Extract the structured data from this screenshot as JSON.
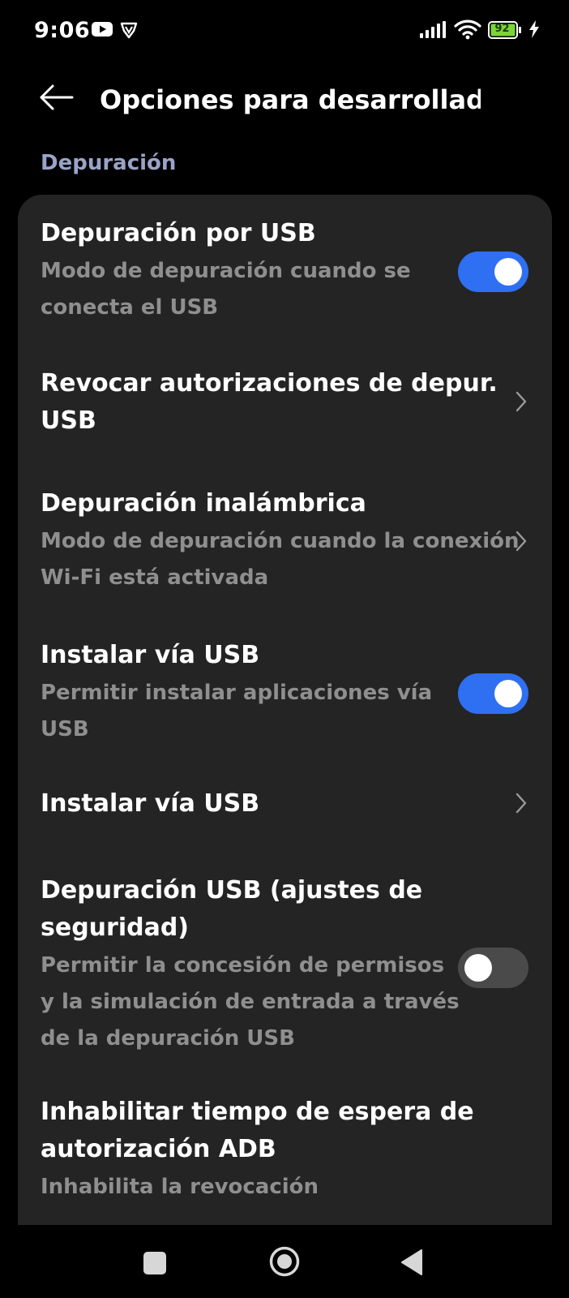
{
  "status_bar": {
    "time": "9:06",
    "battery_level": "92",
    "icons": [
      "youtube-icon",
      "vpn-shield-icon",
      "signal-icon",
      "wifi-icon",
      "battery-icon",
      "charging-bolt-icon"
    ]
  },
  "header": {
    "title": "Opciones para desarrollado…",
    "back_icon": "arrow-left-icon"
  },
  "section": {
    "label": "Depuración"
  },
  "settings": [
    {
      "title": "Depuración por USB",
      "subtitle_lines": [
        "Modo de depuración cuando se",
        "conecta el USB"
      ],
      "control": "toggle",
      "checked": true
    },
    {
      "title_lines": [
        "Revocar autorizaciones de depur.",
        "USB"
      ],
      "control": "chevron"
    },
    {
      "title": "Depuración inalámbrica",
      "subtitle_lines": [
        "Modo de depuración cuando la conexión",
        "Wi-Fi está activada"
      ],
      "control": "chevron"
    },
    {
      "title": "Instalar vía USB",
      "subtitle_lines": [
        "Permitir instalar aplicaciones vía",
        "USB"
      ],
      "control": "toggle",
      "checked": true
    },
    {
      "title": "Instalar vía USB",
      "control": "chevron"
    },
    {
      "title_lines": [
        "Depuración USB (ajustes de",
        "seguridad)"
      ],
      "subtitle_lines": [
        "Permitir la concesión de permisos",
        "y la simulación de entrada a través",
        "de la depuración USB"
      ],
      "control": "toggle",
      "checked": false
    },
    {
      "title_lines": [
        "Inhabilitar tiempo de espera de",
        "autorización ADB"
      ],
      "subtitle_lines": [
        "Inhabilita la revocación"
      ]
    }
  ],
  "colors": {
    "background": "#000000",
    "card": "#242424",
    "section_label": "#9aa3c7",
    "subtitle": "#8f8f8f",
    "toggle_on": "#2f6ff2",
    "toggle_off": "#4a4a4a",
    "battery": "#7cd33a"
  },
  "nav_bar": {
    "icons": [
      "recents-square-icon",
      "home-circle-icon",
      "back-triangle-icon"
    ]
  }
}
